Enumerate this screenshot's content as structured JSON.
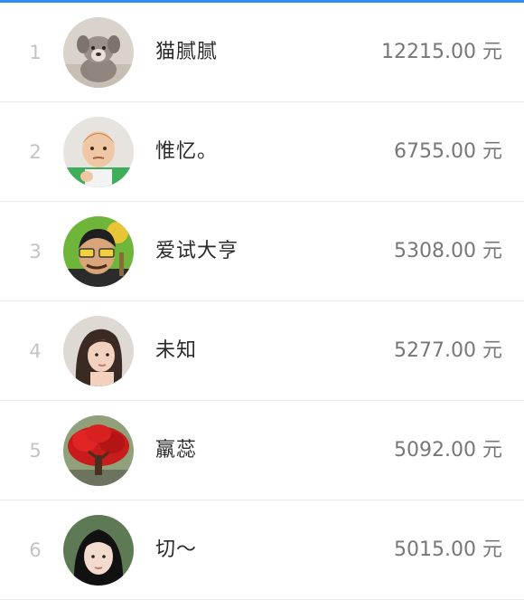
{
  "leaderboard": {
    "accent_color": "#2f8cf0",
    "entries": [
      {
        "rank": "1",
        "name": "猫腻腻",
        "amount": "12215.00 元",
        "avatar_icon": "puppy-avatar-icon"
      },
      {
        "rank": "2",
        "name": "惟忆。",
        "amount": "6755.00 元",
        "avatar_icon": "baby-avatar-icon"
      },
      {
        "rank": "3",
        "name": "爱试大亨",
        "amount": "5308.00 元",
        "avatar_icon": "cartoon-man-avatar-icon"
      },
      {
        "rank": "4",
        "name": "未知",
        "amount": "5277.00 元",
        "avatar_icon": "woman-avatar-icon"
      },
      {
        "rank": "5",
        "name": "羸蕊",
        "amount": "5092.00 元",
        "avatar_icon": "red-tree-avatar-icon"
      },
      {
        "rank": "6",
        "name": "切～",
        "amount": "5015.00 元",
        "avatar_icon": "girl-avatar-icon"
      }
    ]
  }
}
